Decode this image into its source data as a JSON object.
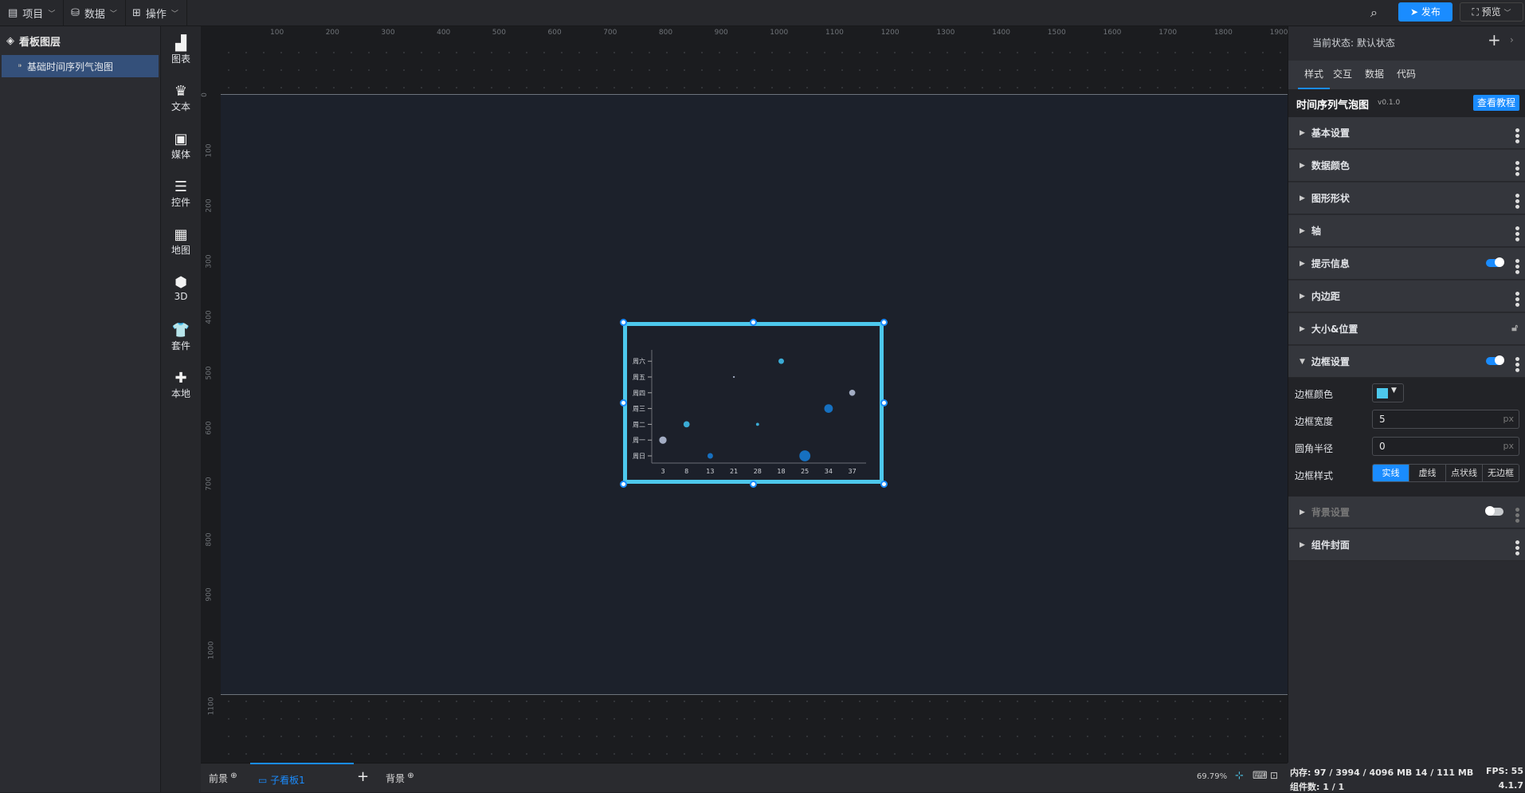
{
  "topbar": {
    "menus": [
      {
        "label": "项目",
        "icon": "file-icon"
      },
      {
        "label": "数据",
        "icon": "database-icon"
      },
      {
        "label": "操作",
        "icon": "grid-icon"
      }
    ],
    "publish": "发布",
    "preview": "预览"
  },
  "layers": {
    "title": "看板图层",
    "items": [
      {
        "label": "基础时间序列气泡图"
      }
    ]
  },
  "toolbar": [
    "图表",
    "文本",
    "媒体",
    "控件",
    "地图",
    "3D",
    "套件",
    "本地"
  ],
  "ruler": {
    "h": [
      "100",
      "200",
      "300",
      "400",
      "500",
      "600",
      "700",
      "800",
      "900",
      "1000",
      "1100",
      "1200",
      "1300",
      "1400",
      "1500",
      "1600",
      "1700",
      "1800",
      "1900"
    ],
    "v": [
      "0",
      "100",
      "200",
      "300",
      "400",
      "500",
      "600",
      "700",
      "800",
      "900",
      "1000",
      "1100"
    ]
  },
  "bottom": {
    "tabs": [
      "前景",
      "子看板1",
      "背景"
    ],
    "zoom": "69.79%"
  },
  "right": {
    "state_label": "当前状态: 默认状态",
    "tabs": [
      "样式",
      "交互",
      "数据",
      "代码"
    ],
    "component_name": "时间序列气泡图",
    "version": "v0.1.0",
    "tutorial": "查看教程",
    "sections": [
      "基本设置",
      "数据颜色",
      "图形形状",
      "轴",
      "提示信息",
      "内边距",
      "大小&位置",
      "边框设置",
      "背景设置",
      "组件封面"
    ],
    "border": {
      "color_label": "边框颜色",
      "color": "#4dc8ec",
      "width_label": "边框宽度",
      "width": "5",
      "radius_label": "圆角半径",
      "radius": "0",
      "unit": "px",
      "style_label": "边框样式",
      "styles": [
        "实线",
        "虚线",
        "点状线",
        "无边框"
      ],
      "active_style": "实线"
    },
    "tooltip_enabled": true,
    "border_enabled": true,
    "background_enabled": false
  },
  "status": {
    "memory": "内存: 97 / 3994 / 4096 MB  14 / 111 MB",
    "fps": "FPS: 55",
    "components": "组件数: 1 / 1",
    "version": "4.1.7"
  },
  "chart_data": {
    "type": "scatter",
    "categories": [
      "3",
      "8",
      "13",
      "21",
      "28",
      "18",
      "25",
      "34",
      "37"
    ],
    "y_categories": [
      "周日",
      "周一",
      "周二",
      "周三",
      "周四",
      "周五",
      "周六"
    ],
    "points": [
      {
        "x": "3",
        "y": "周一",
        "size": 12,
        "color": "#a3adc4"
      },
      {
        "x": "8",
        "y": "周二",
        "size": 10,
        "color": "#3aabd5"
      },
      {
        "x": "13",
        "y": "周日",
        "size": 9,
        "color": "#1670c0"
      },
      {
        "x": "21",
        "y": "周五",
        "size": 3,
        "color": "#a3adc4"
      },
      {
        "x": "28",
        "y": "周二",
        "size": 5,
        "color": "#3aabd5"
      },
      {
        "x": "18",
        "y": "周六",
        "size": 9,
        "color": "#3aabd5"
      },
      {
        "x": "25",
        "y": "周日",
        "size": 18,
        "color": "#1670c0"
      },
      {
        "x": "34",
        "y": "周三",
        "size": 14,
        "color": "#1670c0"
      },
      {
        "x": "37",
        "y": "周四",
        "size": 10,
        "color": "#a3adc4"
      }
    ]
  }
}
